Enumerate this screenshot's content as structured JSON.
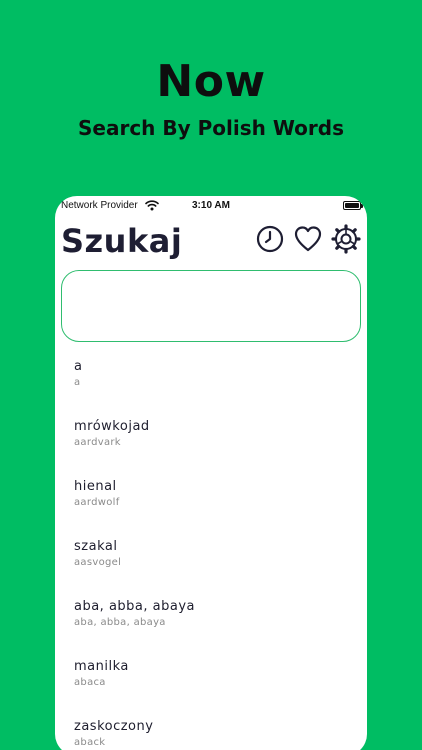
{
  "promo": {
    "headline": "Now",
    "subline": "Search By Polish Words"
  },
  "statusbar": {
    "carrier": "Network Provider",
    "time": "3:10 AM",
    "wifi_icon": "wifi-icon",
    "battery_icon": "battery-icon"
  },
  "header": {
    "title": "Szukaj",
    "buttons": [
      {
        "icon": "clock-icon",
        "name": "history"
      },
      {
        "icon": "heart-icon",
        "name": "favorites"
      },
      {
        "icon": "gear-icon",
        "name": "settings"
      }
    ]
  },
  "search": {
    "value": "",
    "placeholder": ""
  },
  "results": [
    {
      "word": "a",
      "translation": "a"
    },
    {
      "word": "mrówkojad",
      "translation": "aardvark"
    },
    {
      "word": "hienal",
      "translation": "aardwolf"
    },
    {
      "word": "szakal",
      "translation": "aasvogel"
    },
    {
      "word": "aba, abba, abaya",
      "translation": "aba, abba, abaya"
    },
    {
      "word": "manilka",
      "translation": "abaca"
    },
    {
      "word": "zaskoczony",
      "translation": "aback"
    }
  ],
  "colors": {
    "background": "#00bd63",
    "accent_border": "#2fbd6f",
    "title": "#1e1e33",
    "secondary_text": "#8a8a8a"
  }
}
